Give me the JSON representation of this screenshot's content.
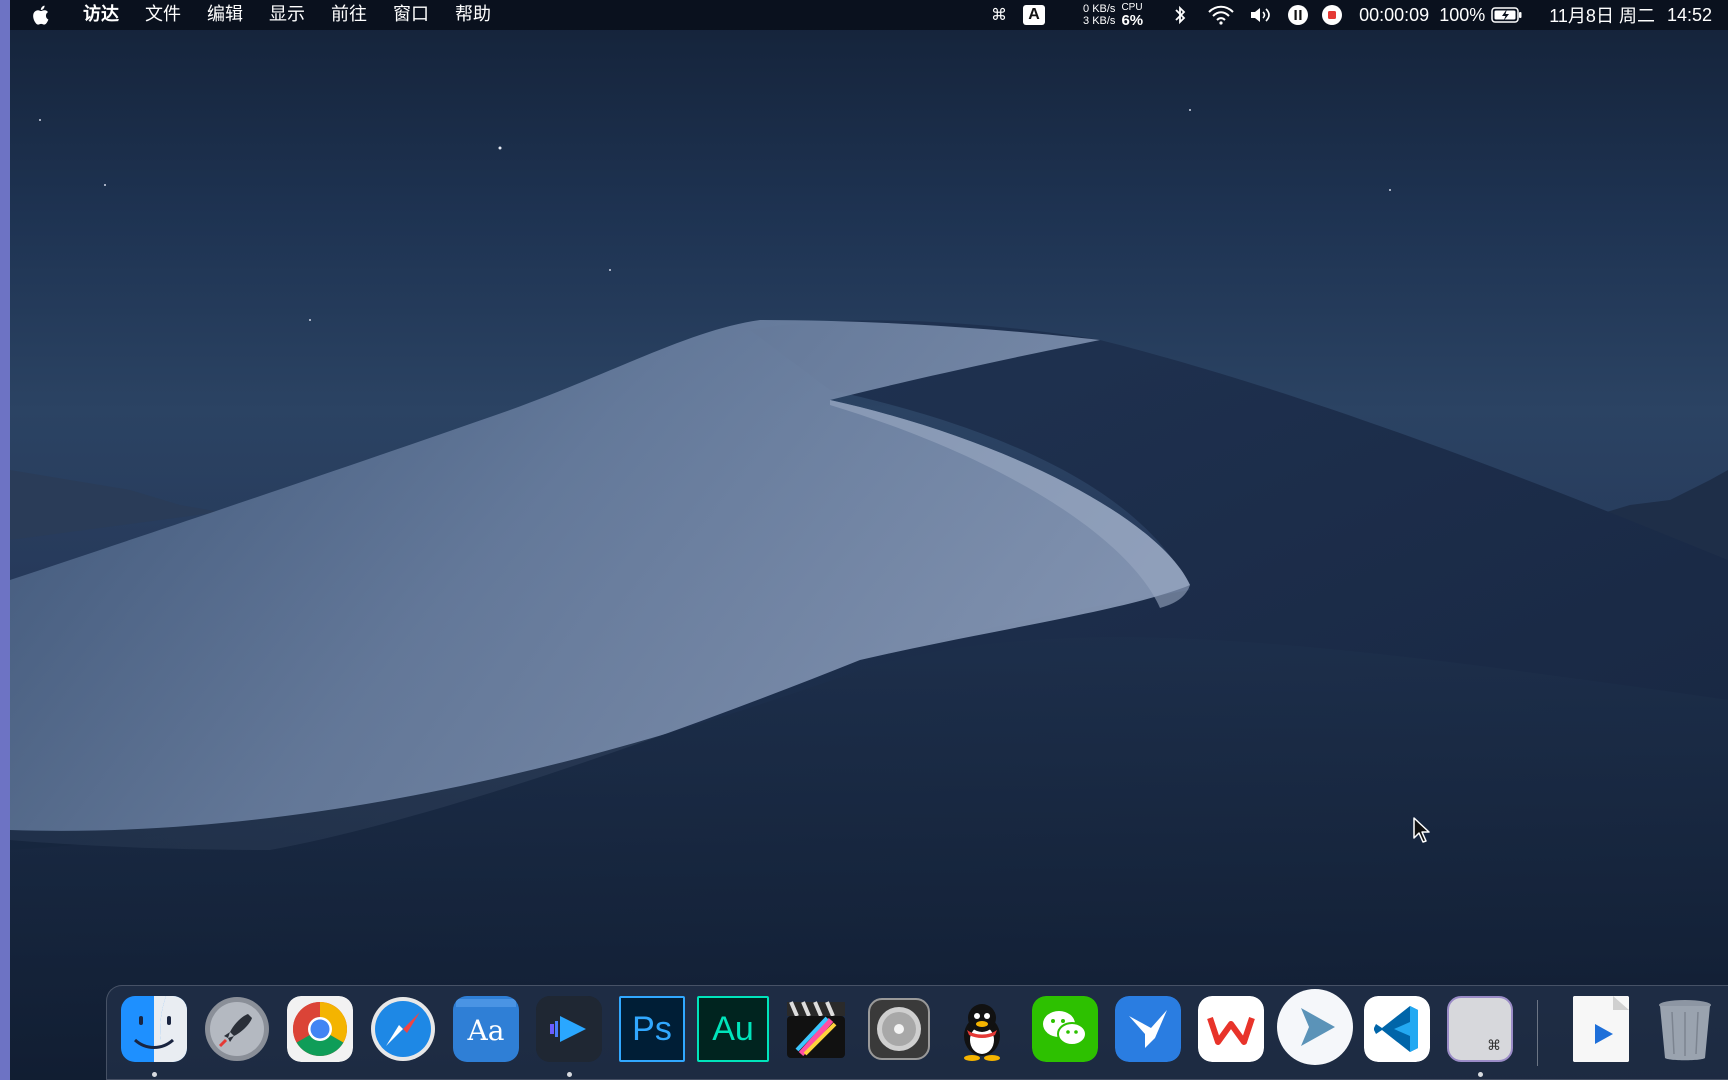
{
  "menubar": {
    "app_name": "访达",
    "menus": [
      "文件",
      "编辑",
      "显示",
      "前往",
      "窗口",
      "帮助"
    ],
    "input_method": "A",
    "net_up": "0 KB/s",
    "net_down": "3 KB/s",
    "cpu_label": "CPU",
    "cpu_value": "6%",
    "recording_time": "00:00:09",
    "battery": "100%",
    "date": "11月8日 周二",
    "time": "14:52"
  },
  "dock": {
    "apps": [
      {
        "name": "finder",
        "running": true
      },
      {
        "name": "launchpad",
        "running": false
      },
      {
        "name": "chrome",
        "running": false
      },
      {
        "name": "safari",
        "running": false
      },
      {
        "name": "dictionary",
        "running": false
      },
      {
        "name": "video-player",
        "running": true
      },
      {
        "name": "photoshop",
        "running": false
      },
      {
        "name": "audition",
        "running": false
      },
      {
        "name": "final-cut-pro",
        "running": false
      },
      {
        "name": "logic-pro",
        "running": false
      },
      {
        "name": "qq",
        "running": false
      },
      {
        "name": "wechat",
        "running": false
      },
      {
        "name": "mail-bird",
        "running": false
      },
      {
        "name": "wps",
        "running": false
      },
      {
        "name": "infuse",
        "running": false
      },
      {
        "name": "vscode",
        "running": false
      },
      {
        "name": "keyboard-app",
        "running": true
      }
    ],
    "ps_label": "Ps",
    "au_label": "Au",
    "dict_label": "Aa",
    "kbd_label": "⌘"
  },
  "colors": {
    "menubar_bg": "#0a101c",
    "left_strip": "#6d73c4",
    "photoshop": "#31a8ff",
    "audition": "#00e4bb",
    "wechat": "#2dc100",
    "vscode": "#23a9f2"
  }
}
